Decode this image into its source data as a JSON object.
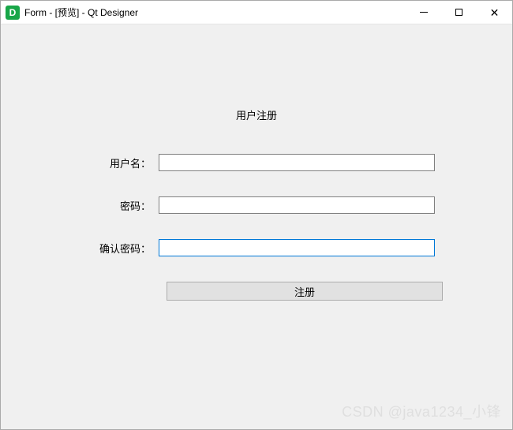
{
  "titlebar": {
    "icon_letter": "D",
    "title": "Form - [预览] - Qt Designer"
  },
  "form": {
    "heading": "用户注册",
    "username_label": "用户名：",
    "username_value": "",
    "password_label": "密码：",
    "password_value": "",
    "confirm_label": "确认密码：",
    "confirm_value": "",
    "submit_label": "注册"
  },
  "watermark": "CSDN @java1234_小锋"
}
